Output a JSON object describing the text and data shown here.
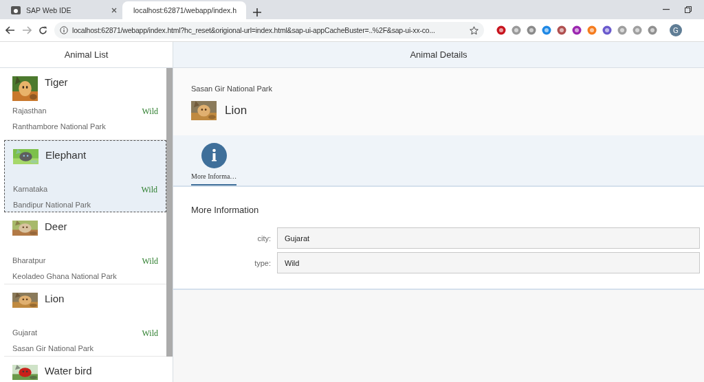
{
  "browser": {
    "tabs": [
      {
        "title": "SAP Web IDE",
        "selected": false
      },
      {
        "title": "localhost:62871/webapp/index.h",
        "selected": true
      }
    ],
    "address": "localhost:62871/webapp/index.html?hc_reset&origional-url=index.html&sap-ui-appCacheBuster=..%2F&sap-ui-xx-co...",
    "profile": "G"
  },
  "master": {
    "title": "Animal List",
    "items": [
      {
        "title": "Tiger",
        "city": "Rajasthan",
        "type": "Wild",
        "park": "Ranthambore National Park",
        "selected": false
      },
      {
        "title": "Elephant",
        "city": "Karnataka",
        "type": "Wild",
        "park": "Bandipur National Park",
        "selected": true
      },
      {
        "title": "Deer",
        "city": "Bharatpur",
        "type": "Wild",
        "park": "Keoladeo Ghana National Park",
        "selected": false
      },
      {
        "title": "Lion",
        "city": "Gujarat",
        "type": "Wild",
        "park": "Sasan Gir National Park",
        "selected": false
      },
      {
        "title": "Water bird",
        "selected": false
      }
    ]
  },
  "detail": {
    "title": "Animal Details",
    "subtitle": "Sasan Gir National Park",
    "name": "Lion",
    "tabs": [
      {
        "label": "More Informa…",
        "selected": true
      }
    ],
    "section": "More Information",
    "fields": [
      {
        "label": "city:",
        "value": "Gujarat"
      },
      {
        "label": "type:",
        "value": "Wild"
      }
    ]
  }
}
